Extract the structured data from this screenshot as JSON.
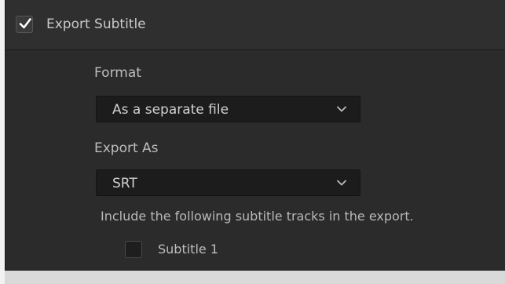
{
  "export_subtitle": {
    "checked": true,
    "title": "Export Subtitle"
  },
  "format": {
    "label": "Format",
    "selected": "As a separate file"
  },
  "export_as": {
    "label": "Export As",
    "selected": "SRT"
  },
  "tracks": {
    "description": "Include the following subtitle tracks in the export.",
    "items": [
      {
        "label": "Subtitle 1",
        "checked": false
      }
    ]
  },
  "colors": {
    "panel_bg": "#2b2b2b",
    "dropdown_bg": "#1c1c1c",
    "text": "#bdbdbd"
  },
  "icons": {
    "check": "check-icon",
    "dropdown": "chevron-down-icon"
  }
}
